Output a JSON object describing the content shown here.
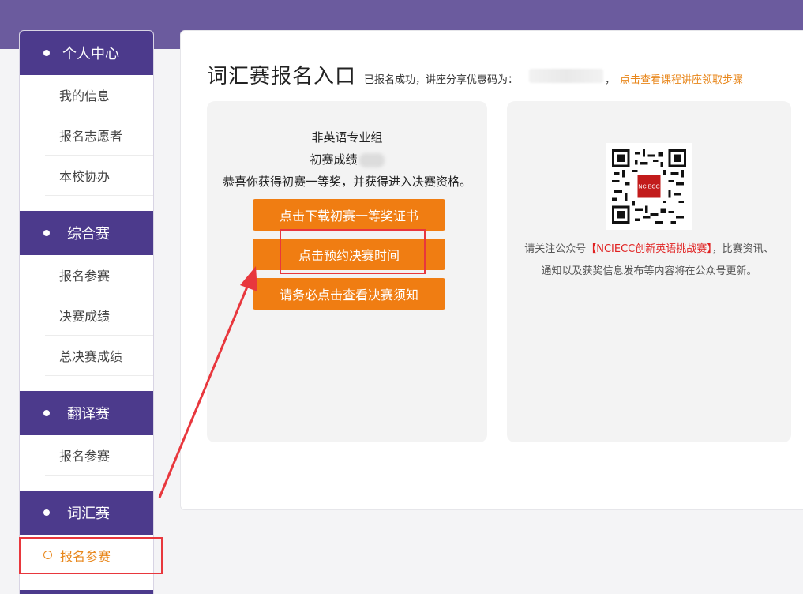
{
  "sidebar": {
    "sections": [
      {
        "title": "个人中心",
        "items": [
          "我的信息",
          "报名志愿者",
          "本校协办"
        ]
      },
      {
        "title": "综合赛",
        "items": [
          "报名参赛",
          "决赛成绩",
          "总决赛成绩"
        ]
      },
      {
        "title": "翻译赛",
        "items": [
          "报名参赛"
        ]
      },
      {
        "title": "词汇赛",
        "items": [
          "报名参赛"
        ]
      }
    ]
  },
  "main": {
    "title": "词汇赛报名入口",
    "success_text": "已报名成功，讲座分享优惠码为：",
    "comma": "，",
    "link_steps": "点击查看课程讲座领取步骤",
    "left_card": {
      "group": "非英语专业组",
      "score_label": "初赛成绩",
      "congrats": "恭喜你获得初赛一等奖，并获得进入决赛资格。",
      "buttons": [
        "点击下载初赛一等奖证书",
        "点击预约决赛时间",
        "请务必点击查看决赛须知"
      ]
    },
    "right_card": {
      "follow_prefix": "请关注公众号",
      "follow_highlight": "【NCIECC创新英语挑战赛】",
      "follow_suffix": "，比赛资讯、通知以及获奖信息发布等内容将在公众号更新。",
      "qr_logo_text": "NCIECC"
    }
  },
  "colors": {
    "header": "#6b5b9e",
    "section": "#4c3a8c",
    "accent": "#f07d12",
    "annotation": "#e8373d",
    "highlight": "#e02020"
  }
}
